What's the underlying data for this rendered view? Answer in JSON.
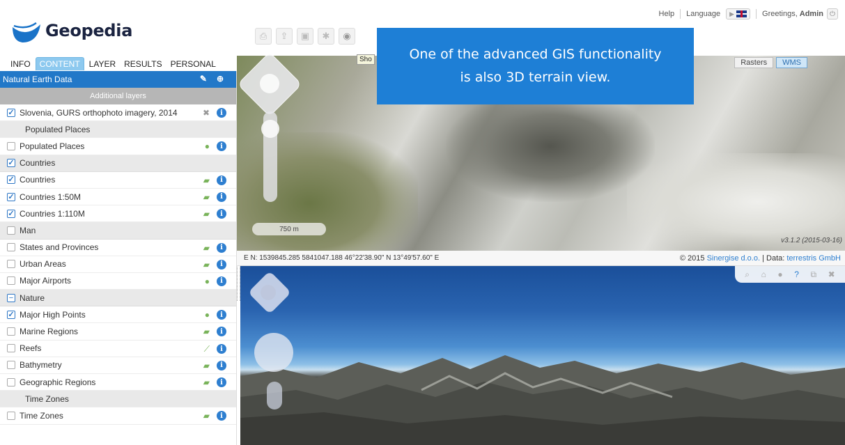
{
  "logo": {
    "text": "Geopedia"
  },
  "topbar": {
    "help": "Help",
    "language": "Language",
    "greeting": "Greetings,",
    "user": "Admin"
  },
  "tabs": [
    "INFO",
    "CONTENT",
    "LAYER",
    "RESULTS",
    "PERSONAL"
  ],
  "active_tab": "CONTENT",
  "panel": {
    "title": "Natural Earth Data",
    "additional_layers": "Additional layers",
    "rows": [
      {
        "label": "Slovenia, GURS orthophoto imagery, 2014",
        "checked": true
      },
      {
        "label": "Populated Places",
        "group": true
      },
      {
        "label": "Populated Places",
        "checked": false
      },
      {
        "label": "Countries",
        "group": true,
        "checked": true
      },
      {
        "label": "Countries",
        "checked": true
      },
      {
        "label": "Countries 1:50M",
        "checked": true
      },
      {
        "label": "Countries 1:110M",
        "checked": true
      },
      {
        "label": "Man",
        "group": true,
        "checked": false
      },
      {
        "label": "States and Provinces",
        "checked": false
      },
      {
        "label": "Urban Areas",
        "checked": false
      },
      {
        "label": "Major Airports",
        "checked": false
      },
      {
        "label": "Nature",
        "group": true
      },
      {
        "label": "Major High Points",
        "checked": true
      },
      {
        "label": "Marine Regions",
        "checked": false
      },
      {
        "label": "Reefs",
        "checked": false
      },
      {
        "label": "Bathymetry",
        "checked": false
      },
      {
        "label": "Geographic Regions",
        "checked": false
      },
      {
        "label": "Time Zones",
        "group": true
      },
      {
        "label": "Time Zones",
        "checked": false
      }
    ]
  },
  "tooltip": "Sho",
  "map": {
    "rasters": "Rasters",
    "wms": "WMS",
    "scale": "750 m",
    "version": "v3.1.2 (2015-03-16)"
  },
  "banner": {
    "line1": "One of the advanced GIS functionality",
    "line2": "is also 3D terrain view."
  },
  "status": {
    "coords": "E N: 1539845.285 5841047.188   46°22'38.90\" N 13°49'57.60\" E",
    "copyright": "© 2015",
    "company": "Sinergise d.o.o.",
    "data_label": " | Data:",
    "data_src": "terrestris GmbH"
  }
}
